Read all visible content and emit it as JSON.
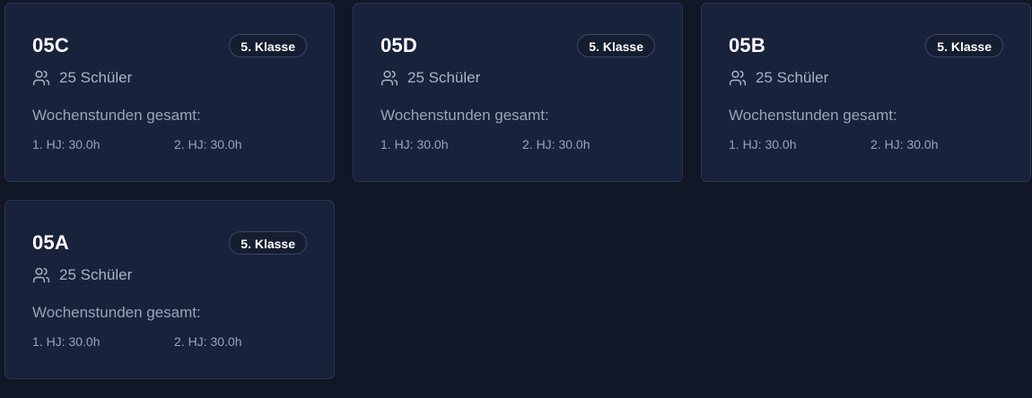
{
  "hours_label": "Wochenstunden gesamt:",
  "classes": [
    {
      "name": "05C",
      "grade": "5. Klasse",
      "students": "25 Schüler",
      "hj1": "1. HJ: 30.0h",
      "hj2": "2. HJ: 30.0h"
    },
    {
      "name": "05D",
      "grade": "5. Klasse",
      "students": "25 Schüler",
      "hj1": "1. HJ: 30.0h",
      "hj2": "2. HJ: 30.0h"
    },
    {
      "name": "05B",
      "grade": "5. Klasse",
      "students": "25 Schüler",
      "hj1": "1. HJ: 30.0h",
      "hj2": "2. HJ: 30.0h"
    },
    {
      "name": "05A",
      "grade": "5. Klasse",
      "students": "25 Schüler",
      "hj1": "1. HJ: 30.0h",
      "hj2": "2. HJ: 30.0h"
    }
  ],
  "colors": {
    "background": "#111726",
    "card": "#18223b",
    "card_border": "#2a3550",
    "text_primary": "#ffffff",
    "text_muted": "#9aa3b5"
  },
  "icons": {
    "students": "users-icon"
  }
}
